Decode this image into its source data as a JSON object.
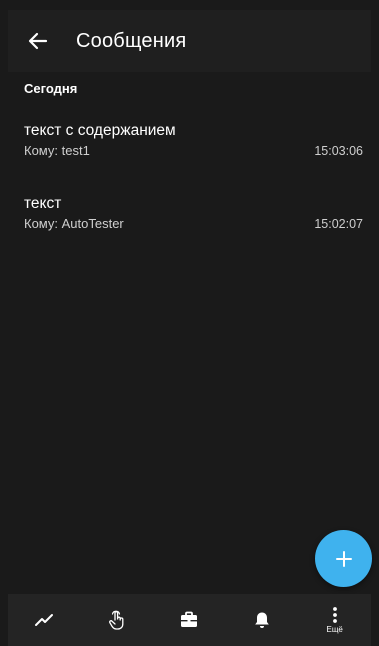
{
  "header": {
    "title": "Сообщения",
    "back_icon": "arrow-left-icon"
  },
  "section": {
    "label": "Сегодня"
  },
  "messages": [
    {
      "title": "текст с содержанием",
      "recipient": "Кому: test1",
      "time": "15:03:06"
    },
    {
      "title": "текст",
      "recipient": "Кому: AutoTester",
      "time": "15:02:07"
    }
  ],
  "fab": {
    "icon": "plus-icon",
    "color": "#3fb2ee"
  },
  "bottom_nav": {
    "items": [
      {
        "icon": "trend-chart-icon",
        "label": ""
      },
      {
        "icon": "hand-touch-icon",
        "label": ""
      },
      {
        "icon": "briefcase-icon",
        "label": ""
      },
      {
        "icon": "bell-icon",
        "label": ""
      },
      {
        "icon": "more-vertical-icon",
        "label": "Ещё"
      }
    ]
  },
  "colors": {
    "background": "#1a1a1a",
    "app_bar": "#1f1f1f",
    "bottom_nav": "#242424",
    "accent": "#3fb2ee"
  }
}
